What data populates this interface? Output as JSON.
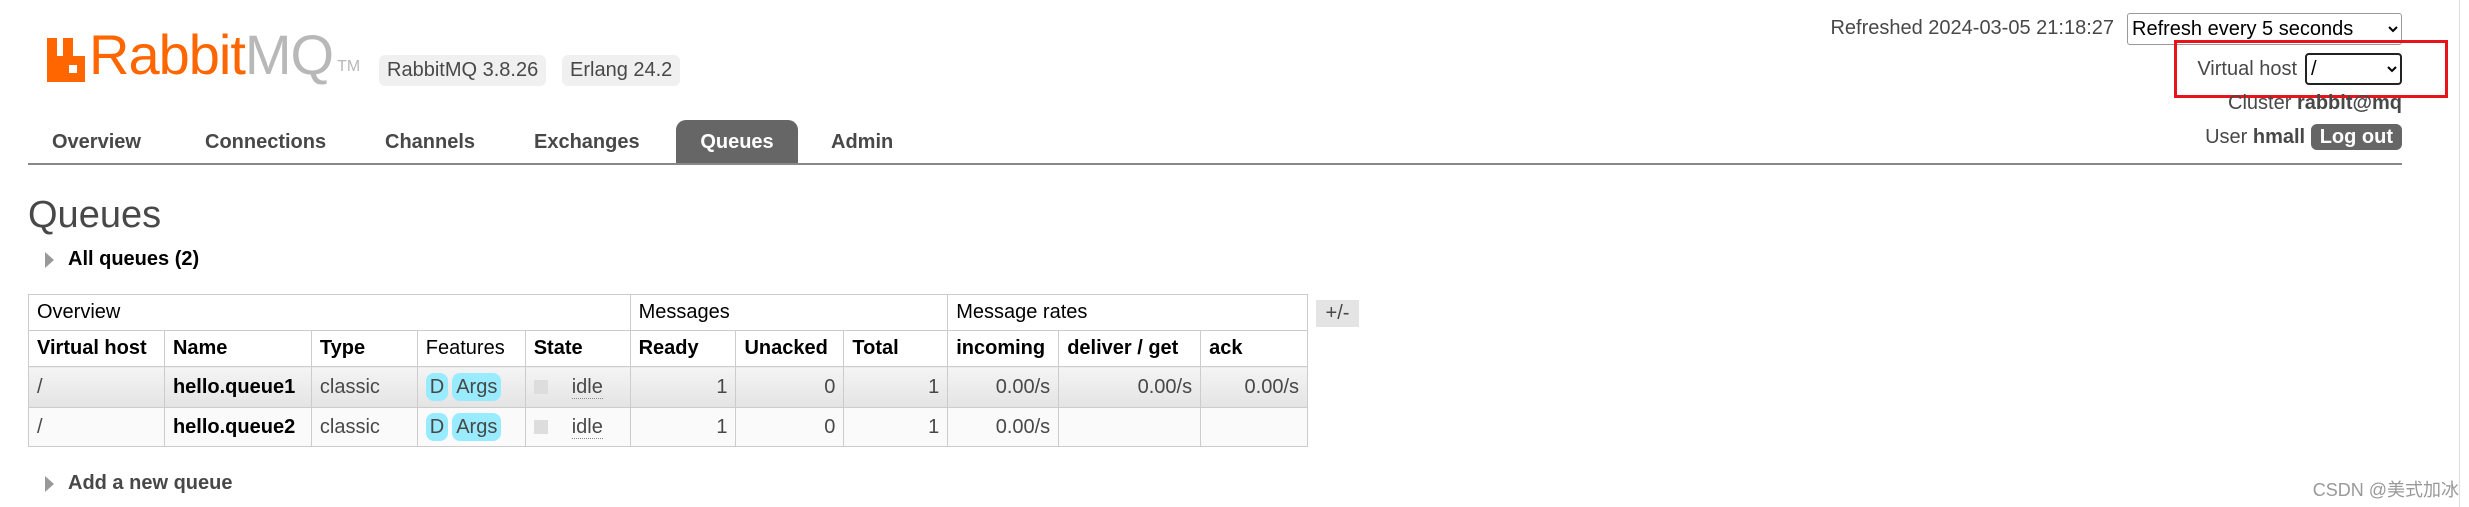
{
  "logo": {
    "text_orange": "Rabbit",
    "text_grey": "MQ",
    "tm": "TM"
  },
  "versions": {
    "rabbitmq": "RabbitMQ 3.8.26",
    "erlang": "Erlang 24.2"
  },
  "tabs": [
    {
      "label": "Overview",
      "active": false
    },
    {
      "label": "Connections",
      "active": false
    },
    {
      "label": "Channels",
      "active": false
    },
    {
      "label": "Exchanges",
      "active": false
    },
    {
      "label": "Queues",
      "active": true
    },
    {
      "label": "Admin",
      "active": false
    }
  ],
  "header_right": {
    "refreshed_label": "Refreshed 2024-03-05 21:18:27",
    "refresh_select": "Refresh every 5 seconds",
    "vhost_label": "Virtual host",
    "vhost_select": "/",
    "cluster_label": "Cluster",
    "cluster_value": "rabbit@mq",
    "user_label": "User",
    "user_value": "hmall",
    "logout": "Log out",
    "highlight_color": "#e8141c"
  },
  "page": {
    "title": "Queues",
    "all_queues": "All queues (2)",
    "add_queue": "Add a new queue",
    "toggle_columns": "+/-"
  },
  "table": {
    "groups": [
      "Overview",
      "Messages",
      "Message rates"
    ],
    "columns": [
      "Virtual host",
      "Name",
      "Type",
      "Features",
      "State",
      "Ready",
      "Unacked",
      "Total",
      "incoming",
      "deliver / get",
      "ack"
    ],
    "rows": [
      {
        "vhost": "/",
        "name": "hello.queue1",
        "type": "classic",
        "feature_d": "D",
        "feature_args": "Args",
        "state": "idle",
        "ready": "1",
        "unacked": "0",
        "total": "1",
        "incoming": "0.00/s",
        "deliver_get": "0.00/s",
        "ack": "0.00/s"
      },
      {
        "vhost": "/",
        "name": "hello.queue2",
        "type": "classic",
        "feature_d": "D",
        "feature_args": "Args",
        "state": "idle",
        "ready": "1",
        "unacked": "0",
        "total": "1",
        "incoming": "0.00/s",
        "deliver_get": "",
        "ack": ""
      }
    ]
  },
  "watermark": "CSDN @美式加冰"
}
